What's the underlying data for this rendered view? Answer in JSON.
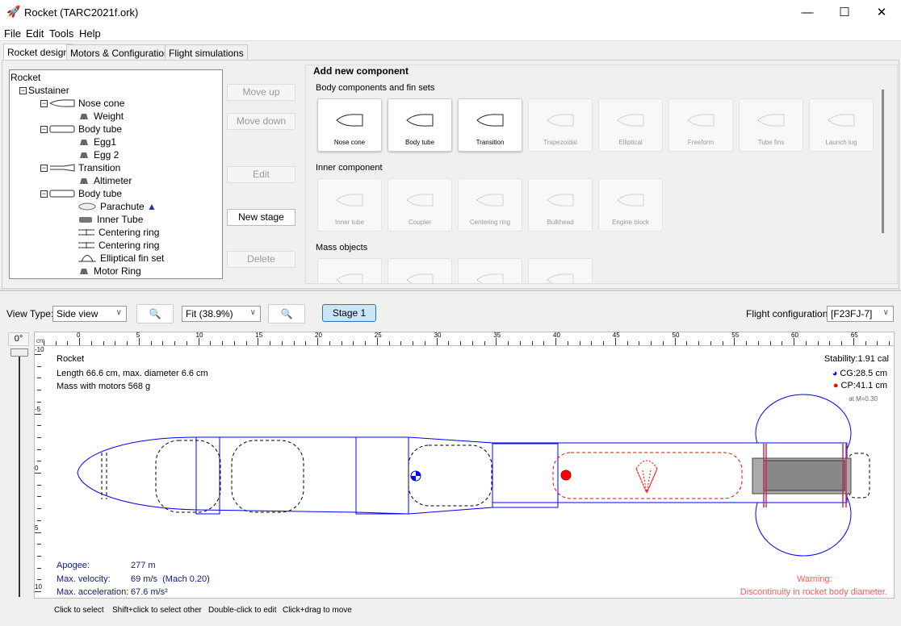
{
  "window": {
    "title": "Rocket (TARC2021f.ork)",
    "minimize": "—",
    "maximize": "☐",
    "close": "✕"
  },
  "menu": [
    "File",
    "Edit",
    "Tools",
    "Help"
  ],
  "tabs": [
    "Rocket design",
    "Motors & Configuration",
    "Flight simulations"
  ],
  "tree": [
    {
      "label": "Rocket",
      "depth": 0,
      "icon": "none"
    },
    {
      "label": "Sustainer",
      "depth": 1,
      "icon": "none"
    },
    {
      "label": "Nose cone",
      "depth": 2,
      "icon": "nose-cone"
    },
    {
      "label": "Weight",
      "depth": 3,
      "icon": "mass"
    },
    {
      "label": "Body tube",
      "depth": 2,
      "icon": "body-tube"
    },
    {
      "label": "Egg1",
      "depth": 3,
      "icon": "mass"
    },
    {
      "label": "Egg 2",
      "depth": 3,
      "icon": "mass"
    },
    {
      "label": "Transition",
      "depth": 2,
      "icon": "transition"
    },
    {
      "label": "Altimeter",
      "depth": 3,
      "icon": "mass"
    },
    {
      "label": "Body tube",
      "depth": 2,
      "icon": "body-tube"
    },
    {
      "label": "Parachute",
      "depth": 3,
      "icon": "parachute"
    },
    {
      "label": "Inner Tube",
      "depth": 3,
      "icon": "inner-tube"
    },
    {
      "label": "Centering ring",
      "depth": 3,
      "icon": "centering-ring"
    },
    {
      "label": "Centering ring",
      "depth": 3,
      "icon": "centering-ring"
    },
    {
      "label": "Elliptical fin set",
      "depth": 3,
      "icon": "fin"
    },
    {
      "label": "Motor Ring",
      "depth": 3,
      "icon": "mass"
    }
  ],
  "buttons": {
    "move_up": "Move up",
    "move_down": "Move down",
    "edit": "Edit",
    "new_stage": "New stage",
    "delete": "Delete"
  },
  "add_component": {
    "title": "Add new component",
    "sections": [
      {
        "title": "Body components and fin sets",
        "items": [
          {
            "label": "Nose cone",
            "enabled": true
          },
          {
            "label": "Body tube",
            "enabled": true
          },
          {
            "label": "Transition",
            "enabled": true
          },
          {
            "label": "Trapezoidal",
            "enabled": false
          },
          {
            "label": "Elliptical",
            "enabled": false
          },
          {
            "label": "Freeform",
            "enabled": false
          },
          {
            "label": "Tube fins",
            "enabled": false
          },
          {
            "label": "Launch lug",
            "enabled": false
          }
        ]
      },
      {
        "title": "Inner component",
        "items": [
          {
            "label": "Inner tube",
            "enabled": false
          },
          {
            "label": "Coupler",
            "enabled": false
          },
          {
            "label": "Centering ring",
            "enabled": false
          },
          {
            "label": "Bulkhead",
            "enabled": false
          },
          {
            "label": "Engine block",
            "enabled": false
          }
        ]
      },
      {
        "title": "Mass objects",
        "items": [
          {
            "label": "",
            "enabled": false
          },
          {
            "label": "",
            "enabled": false
          },
          {
            "label": "",
            "enabled": false
          },
          {
            "label": "",
            "enabled": false
          }
        ]
      }
    ]
  },
  "view": {
    "view_type_label": "View Type:",
    "view_type": "Side view",
    "zoom": "Fit (38.9%)",
    "stage": "Stage 1",
    "flight_config_label": "Flight configuration:",
    "flight_config": "[F23FJ-7]",
    "rotation": "0°",
    "unit": "cm"
  },
  "ruler": {
    "h": [
      "0",
      "5",
      "10",
      "15",
      "20",
      "25",
      "30",
      "35",
      "40",
      "45",
      "50",
      "55",
      "60",
      "65"
    ],
    "v": [
      "-10",
      "-5",
      "0",
      "5",
      "10"
    ]
  },
  "info": {
    "name": "Rocket",
    "dims": "Length 66.6 cm, max. diameter 6.6 cm",
    "mass": "Mass with motors 568 g",
    "stability": "Stability:1.91 cal",
    "cg": "CG:28.5 cm",
    "cp": "CP:41.1 cm",
    "mach": "at M=0.30"
  },
  "flight": {
    "apogee_label": "Apogee:",
    "apogee": "277 m",
    "vel_label": "Max. velocity:",
    "vel": "69 m/s  (Mach 0.20)",
    "acc_label": "Max. acceleration:",
    "acc": "67.6 m/s²"
  },
  "warning": {
    "title": "Warning:",
    "text": "Discontinuity in rocket body diameter."
  },
  "status": [
    "Click to select",
    "Shift+click to select other",
    "Double-click to edit",
    "Click+drag to move"
  ],
  "colors": {
    "outline": "#0000ff",
    "cp": "#ff0000",
    "warning": "#ff5a5a",
    "info": "#0f1a7a",
    "stage_btn": "#cce4f7"
  }
}
